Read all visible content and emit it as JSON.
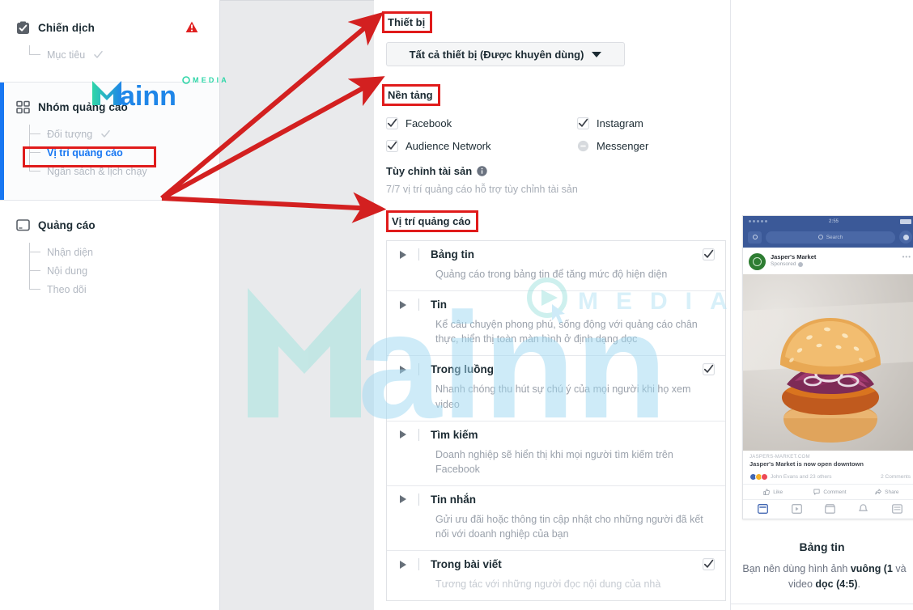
{
  "sidebar": {
    "sections": [
      {
        "name": "campaign",
        "title": "Chiến dịch",
        "icon": "clipboard-check-icon",
        "has_warning": true,
        "items": [
          {
            "label": "Mục tiêu",
            "state": "done",
            "active": false
          }
        ]
      },
      {
        "name": "adset",
        "title": "Nhóm quảng cáo",
        "icon": "grid-squares-icon",
        "has_warning": false,
        "items": [
          {
            "label": "Đối tượng",
            "state": "done",
            "active": false
          },
          {
            "label": "Vị trí quảng cáo",
            "state": "current",
            "active": true
          },
          {
            "label": "Ngân sách & lịch chạy",
            "state": "todo",
            "active": false
          }
        ]
      },
      {
        "name": "ad",
        "title": "Quảng cáo",
        "icon": "monitor-icon",
        "has_warning": false,
        "items": [
          {
            "label": "Nhận diện",
            "state": "todo",
            "active": false
          },
          {
            "label": "Nội dung",
            "state": "todo",
            "active": false
          },
          {
            "label": "Theo dõi",
            "state": "todo",
            "active": false
          }
        ]
      }
    ]
  },
  "main": {
    "device": {
      "label": "Thiết bị",
      "selected": "Tất cả thiết bị (Được khuyên dùng)"
    },
    "platform": {
      "label": "Nền tảng",
      "options": [
        {
          "label": "Facebook",
          "state": "checked"
        },
        {
          "label": "Instagram",
          "state": "checked"
        },
        {
          "label": "Audience Network",
          "state": "checked"
        },
        {
          "label": "Messenger",
          "state": "partial"
        }
      ]
    },
    "asset_customization": {
      "label": "Tùy chỉnh tài sản",
      "info_icon": "info-icon",
      "note": "7/7 vị trí quảng cáo hỗ trợ tùy chỉnh tài sản"
    },
    "placements": {
      "label": "Vị trí quảng cáo",
      "rows": [
        {
          "title": "Bảng tin",
          "desc": "Quảng cáo trong bảng tin để tăng mức độ hiện diện",
          "checked": true
        },
        {
          "title": "Tin",
          "desc": "Kể câu chuyện phong phú, sống động với quảng cáo chân thực, hiển thị toàn màn hình ở định dạng dọc",
          "checked": false
        },
        {
          "title": "Trong luồng",
          "desc": "Nhanh chóng thu hút sự chú ý của mọi người khi họ xem video",
          "checked": true
        },
        {
          "title": "Tìm kiếm",
          "desc": "Doanh nghiệp sẽ hiển thị khi mọi người tìm kiếm trên Facebook",
          "checked": false
        },
        {
          "title": "Tin nhắn",
          "desc": "Gửi ưu đãi hoặc thông tin cập nhật cho những người đã kết nối với doanh nghiệp của bạn",
          "checked": false
        },
        {
          "title": "Trong bài viết",
          "desc": "Tương tác với những người đọc nội dung của nhà",
          "checked": true
        }
      ]
    }
  },
  "preview": {
    "phone": {
      "status_time": "2:55",
      "search_placeholder": "Search",
      "page_name": "Jasper's Market",
      "sponsored": "Sponsored",
      "link_url": "JASPERS-MARKET.COM",
      "headline": "Jasper's Market is now open downtown",
      "reactions": "John Evans and 23 others",
      "comments": "2 Comments",
      "actions": [
        "Like",
        "Comment",
        "Share"
      ]
    },
    "title": "Bảng tin",
    "description_prefix": "Bạn nên dùng hình ảnh ",
    "description_bold1": "vuông (1",
    "description_mid": " và video ",
    "description_bold2": "dọc (4:5)",
    "description_suffix": "."
  },
  "annotations": {
    "highlight_color": "#e01b1b",
    "arrow_color": "#d32020",
    "boxed_labels": [
      "Thiết bị",
      "Nền tảng",
      "Vị trí quảng cáo",
      "Vị trí quảng cáo"
    ]
  },
  "watermark": {
    "brand": "Mainn",
    "tag": "MEDIA",
    "logo_green": "#2fd6a8",
    "logo_blue": "#1f86e8",
    "wm_color": "#bfe9f5"
  }
}
